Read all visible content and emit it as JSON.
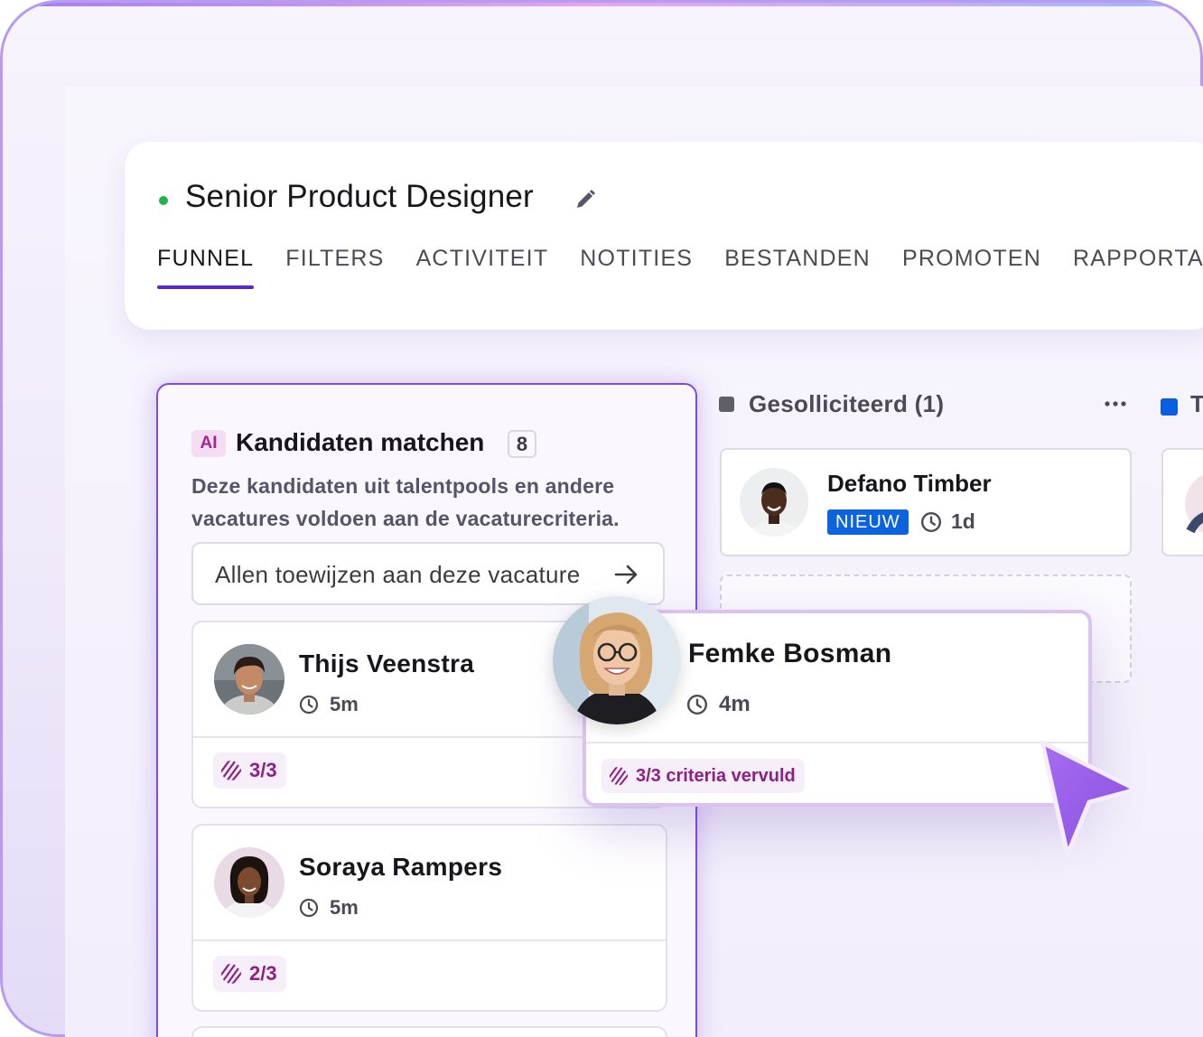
{
  "job": {
    "title": "Senior Product Designer",
    "status_color": "#1fb34a"
  },
  "tabs": [
    {
      "label": "FUNNEL",
      "active": true
    },
    {
      "label": "FILTERS"
    },
    {
      "label": "ACTIVITEIT"
    },
    {
      "label": "NOTITIES"
    },
    {
      "label": "BESTANDEN"
    },
    {
      "label": "PROMOTEN"
    },
    {
      "label": "RAPPORTAGE"
    }
  ],
  "ai_matching": {
    "badge": "AI",
    "title": "Kandidaten matchen",
    "count": "8",
    "description": "Deze kandidaten uit talentpools en andere vacatures voldoen aan de vacaturecriteria.",
    "assign_label": "Allen toewijzen aan deze vacature",
    "candidates": [
      {
        "name": "Thijs Veenstra",
        "time": "5m",
        "match": "3/3"
      },
      {
        "name": "Soraya Rampers",
        "time": "5m",
        "match": "2/3"
      }
    ]
  },
  "columns": [
    {
      "title": "Gesolliciteerd (1)",
      "color": "#5f5f69"
    },
    {
      "title": "T",
      "color": "#0a5fe0"
    }
  ],
  "applicant": {
    "name": "Defano Timber",
    "badge": "NIEUW",
    "time": "1d"
  },
  "dragged_card": {
    "name": "Femke Bosman",
    "time": "4m",
    "criteria": "3/3 criteria vervuld"
  },
  "colors": {
    "accent": "#5a2bc2",
    "ai_border": "#7b4fdc",
    "new_badge": "#0b63dd",
    "match_text": "#8e1f86",
    "cursor": "#9b5ee6"
  },
  "icons": [
    "pencil-icon",
    "arrow-right-icon",
    "clock-icon",
    "striped-match-icon",
    "more-dots-icon",
    "cursor-arrow-icon"
  ]
}
